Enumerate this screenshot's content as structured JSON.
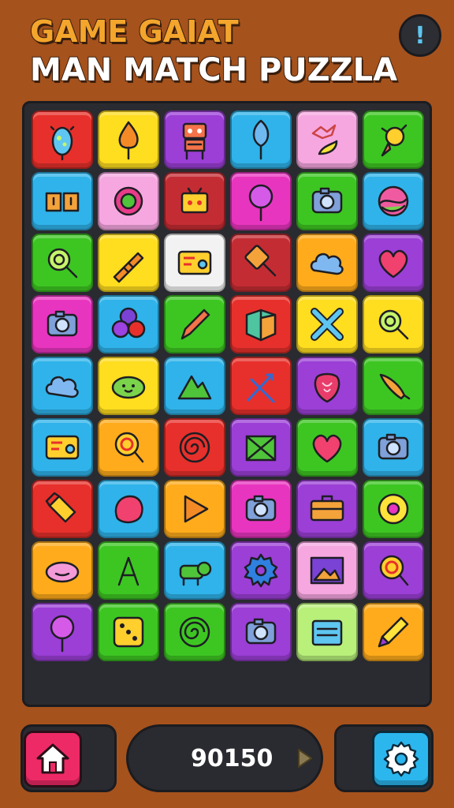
{
  "header": {
    "title_line1": "GAME GAIAT",
    "title_line2": "MAN MATCH PUZZLA",
    "info_label": "!"
  },
  "colors": {
    "background": "#a5521d",
    "board": "#2a2b30",
    "title_orange": "#f3a52c",
    "red": "#e7302b",
    "yellow": "#ffdd1f",
    "purple": "#9b3fd6",
    "blue": "#2fb3ea",
    "pink": "#f6a7e0",
    "green": "#3dc622",
    "magenta": "#e835bf",
    "orange": "#ffab1b",
    "white": "#f2f2f2",
    "crimson": "#c42c33",
    "lightgreen": "#b8f07a",
    "lightblue": "#6fd0f5"
  },
  "grid": {
    "rows": [
      [
        {
          "bg": "red",
          "icon": "egg-icon"
        },
        {
          "bg": "yellow",
          "icon": "flame-icon"
        },
        {
          "bg": "purple",
          "icon": "robot-icon"
        },
        {
          "bg": "blue",
          "icon": "ice-pop-icon"
        },
        {
          "bg": "pink",
          "icon": "bird-icon"
        },
        {
          "bg": "green",
          "icon": "rocket-icon"
        }
      ],
      [
        {
          "bg": "blue",
          "icon": "boxes-icon"
        },
        {
          "bg": "pink",
          "icon": "sun-gear-icon"
        },
        {
          "bg": "crimson",
          "icon": "gift-box-icon"
        },
        {
          "bg": "magenta",
          "icon": "balloon-icon"
        },
        {
          "bg": "green",
          "icon": "camera-icon"
        },
        {
          "bg": "blue",
          "icon": "ball-icon"
        }
      ],
      [
        {
          "bg": "green",
          "icon": "magnifier-icon"
        },
        {
          "bg": "yellow",
          "icon": "rocket-pop-icon"
        },
        {
          "bg": "white",
          "icon": "card-icon"
        },
        {
          "bg": "crimson",
          "icon": "paddle-icon"
        },
        {
          "bg": "orange",
          "icon": "cloud-icon"
        },
        {
          "bg": "purple",
          "icon": "heart-icon"
        }
      ],
      [
        {
          "bg": "magenta",
          "icon": "camera-icon"
        },
        {
          "bg": "blue",
          "icon": "berries-icon"
        },
        {
          "bg": "green",
          "icon": "pencil-icon"
        },
        {
          "bg": "red",
          "icon": "cube-icon"
        },
        {
          "bg": "yellow",
          "icon": "tools-icon"
        },
        {
          "bg": "yellow",
          "icon": "magnifier-icon"
        }
      ],
      [
        {
          "bg": "blue",
          "icon": "cloud-icon"
        },
        {
          "bg": "yellow",
          "icon": "slime-icon"
        },
        {
          "bg": "blue",
          "icon": "mountain-icon"
        },
        {
          "bg": "red",
          "icon": "arrows-icon"
        },
        {
          "bg": "purple",
          "icon": "strawberry-icon"
        },
        {
          "bg": "green",
          "icon": "carrot-icon"
        }
      ],
      [
        {
          "bg": "blue",
          "icon": "card-icon"
        },
        {
          "bg": "orange",
          "icon": "lollipop-icon"
        },
        {
          "bg": "red",
          "icon": "spiral-icon"
        },
        {
          "bg": "purple",
          "icon": "envelope-icon"
        },
        {
          "bg": "green",
          "icon": "heart-icon"
        },
        {
          "bg": "blue",
          "icon": "camera-icon"
        }
      ],
      [
        {
          "bg": "red",
          "icon": "crayon-icon"
        },
        {
          "bg": "blue",
          "icon": "blob-icon"
        },
        {
          "bg": "orange",
          "icon": "play-icon"
        },
        {
          "bg": "magenta",
          "icon": "camera-icon"
        },
        {
          "bg": "purple",
          "icon": "briefcase-icon"
        },
        {
          "bg": "green",
          "icon": "donut-icon"
        }
      ],
      [
        {
          "bg": "orange",
          "icon": "jelly-bean-icon"
        },
        {
          "bg": "green",
          "icon": "easel-icon"
        },
        {
          "bg": "blue",
          "icon": "robot-dog-icon"
        },
        {
          "bg": "purple",
          "icon": "gear-icon"
        },
        {
          "bg": "pink",
          "icon": "picture-icon"
        },
        {
          "bg": "purple",
          "icon": "lollipop-icon"
        }
      ],
      [
        {
          "bg": "purple",
          "icon": "balloon-icon"
        },
        {
          "bg": "green",
          "icon": "dice-icon"
        },
        {
          "bg": "green",
          "icon": "spiral-icon"
        },
        {
          "bg": "purple",
          "icon": "camera-icon"
        },
        {
          "bg": "lightgreen",
          "icon": "folder-icon"
        },
        {
          "bg": "orange",
          "icon": "marker-icon"
        }
      ]
    ]
  },
  "footer": {
    "score": "90150",
    "home_icon": "home-icon",
    "settings_icon": "gear-icon",
    "play_icon": "play-arrow-icon"
  }
}
